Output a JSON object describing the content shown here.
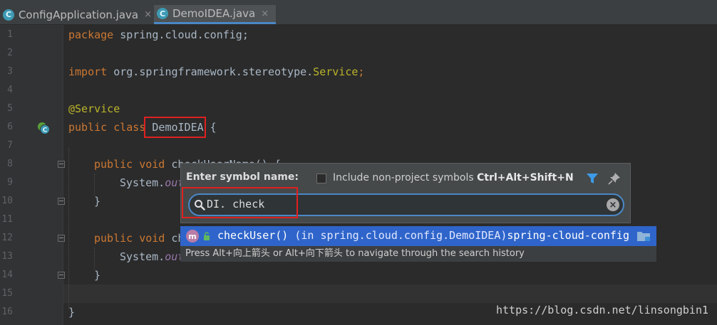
{
  "tabs": [
    {
      "label": "ConfigApplication.java",
      "active": false,
      "icon": "spring-class-icon"
    },
    {
      "label": "DemoIDEA.java",
      "active": true,
      "icon": "class-icon"
    }
  ],
  "tab_icon_letter": "C",
  "close_glyph": "×",
  "line_numbers": [
    "1",
    "2",
    "3",
    "4",
    "5",
    "6",
    "7",
    "8",
    "9",
    "10",
    "11",
    "12",
    "13",
    "14",
    "15",
    "16"
  ],
  "code": {
    "l1_kw": "package",
    "l1_rest": " spring.cloud.config;",
    "l3_kw": "import",
    "l3_pkg": " org.springframework.stereotype.",
    "l3_cls": "Service",
    "l3_semi": ";",
    "l5": "@Service",
    "l6_kw1": "public",
    "l6_kw2": " class ",
    "l6_name": "DemoIDEA",
    "l6_rest": " {",
    "l8_kw": "public void ",
    "l8_rest": "checkUserName() {",
    "l9_obj": "System.",
    "l9_fld": "out",
    "l10": "}",
    "l12_kw": "public void ",
    "l12_rest": "ch",
    "l13_obj": "System.",
    "l13_fld": "out",
    "l14": "}",
    "l16": "}"
  },
  "popup": {
    "title": "Enter symbol name:",
    "checkbox_label": "Include non-project symbols ",
    "checkbox_shortcut": "Ctrl+Alt+Shift+N",
    "checkbox_checked": false,
    "search_value": "DI. check",
    "result_name": "checkUser()",
    "result_location": " (in spring.cloud.config.DemoIDEA)",
    "result_module": "spring-cloud-config",
    "result_icon_letter": "m",
    "hint": "Press Alt+向上箭头 or Alt+向下箭头 to navigate through the search history"
  },
  "watermark": "https://blog.csdn.net/linsongbin1",
  "colors": {
    "editor_bg": "#2b2b2b",
    "keyword": "#cc7832",
    "annotation": "#bbb529",
    "text": "#a9b7c6",
    "selection": "#2f65ca",
    "highlight_box": "#e02020"
  }
}
